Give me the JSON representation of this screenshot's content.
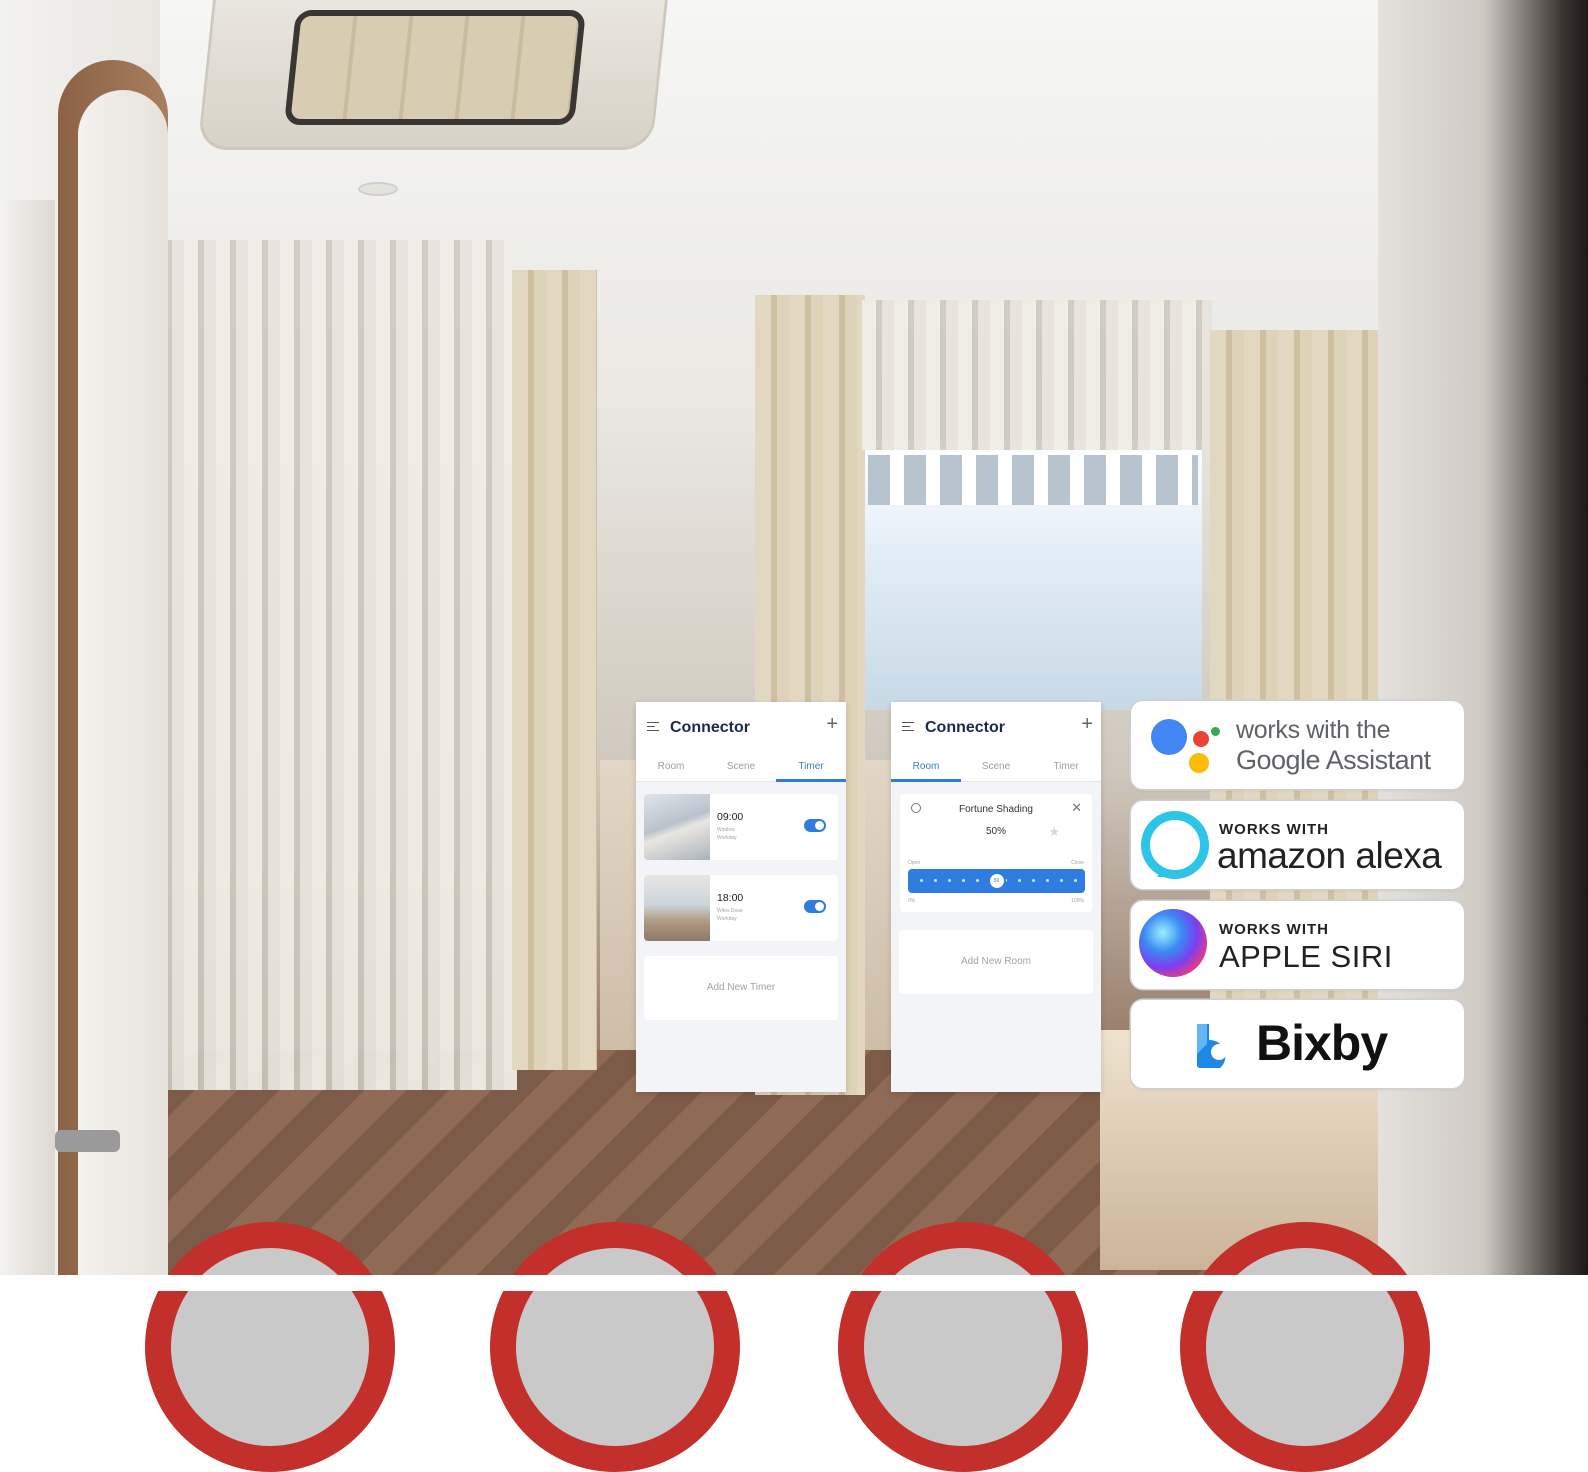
{
  "timer_app": {
    "title": "Connector",
    "plus": "+",
    "tabs": [
      "Room",
      "Scene",
      "Timer"
    ],
    "active_tab": "Timer",
    "timers": [
      {
        "time": "09:00",
        "action": "Window",
        "days": "Workday",
        "enabled": true,
        "thumbnail": "couple-photo"
      },
      {
        "time": "18:00",
        "action": "Wites Dose",
        "days": "Workday",
        "enabled": true,
        "thumbnail": "living-room-photo"
      }
    ],
    "add_label": "Add New Timer"
  },
  "room_app": {
    "title": "Connector",
    "plus": "+",
    "tabs": [
      "Room",
      "Scene",
      "Timer"
    ],
    "active_tab": "Room",
    "device": {
      "name": "Fortune Shading",
      "percent": "50%",
      "close_glyph": "✕",
      "star_glyph": "★",
      "slider_knob": "50",
      "slider_level": 0.5,
      "label_open": "Open",
      "label_close": "Close",
      "label_min": "0%",
      "label_max": "100%"
    },
    "add_label": "Add New Room"
  },
  "badges": {
    "google": {
      "line1": "works with the",
      "line2": "Google Assistant",
      "icon": "google-assistant-icon"
    },
    "alexa": {
      "works_with": "WORKS WITH",
      "name": "amazon alexa",
      "icon": "alexa-icon"
    },
    "siri": {
      "works_with": "WORKS WITH",
      "name": "APPLE SIRI",
      "icon": "siri-icon"
    },
    "bixby": {
      "name": "Bixby",
      "icon": "bixby-icon"
    }
  },
  "colors": {
    "accent_blue": "#2f7de0",
    "title_navy": "#1a2a52",
    "alexa_cyan": "#2ec4e8",
    "google_blue": "#4285f4",
    "google_red": "#ea4335",
    "google_yellow": "#fbbc05",
    "google_green": "#34a853",
    "bixby_blue": "#1e88e5",
    "circle_red": "#c3302b"
  }
}
